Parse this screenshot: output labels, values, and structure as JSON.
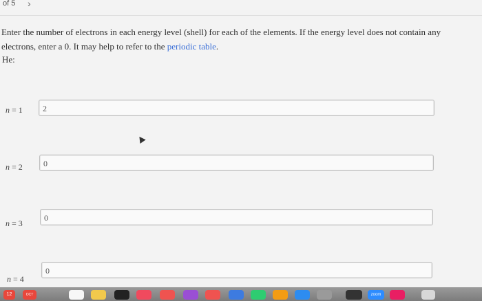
{
  "header": {
    "pager": "of 5",
    "next_icon": "›"
  },
  "question": {
    "text_before_link": "Enter the number of electrons in each energy level (shell) for each of the elements. If the energy level does not contain any electrons, enter a 0. It may help to refer to the ",
    "link_text": "periodic table",
    "text_after_link": ".",
    "element_label": "He:"
  },
  "rows": [
    {
      "n_symbol": "n",
      "eq": " = 1",
      "value": "2"
    },
    {
      "n_symbol": "n",
      "eq": " = 2",
      "value": "0"
    },
    {
      "n_symbol": "n",
      "eq": " = 3",
      "value": "0"
    },
    {
      "n_symbol": "n",
      "eq": " = 4",
      "value": "0"
    }
  ],
  "dock": {
    "calendar_day": "12",
    "calendar_month": "OCT",
    "zoom_label": "zoom",
    "colors": {
      "calendar": "#e8473c",
      "notes": "#f2c94c",
      "tv": "#222222",
      "music": "#f04a5e",
      "podcasts": "#9a4fd4",
      "news": "#ef5350",
      "keynote": "#3d7be0",
      "numbers": "#2ecc71",
      "pages": "#f39c12",
      "appstore": "#2d8cf0",
      "settings": "#9a9a9a",
      "piano": "#333333",
      "zoom": "#2d8cff",
      "photos": "#e91e63"
    }
  }
}
